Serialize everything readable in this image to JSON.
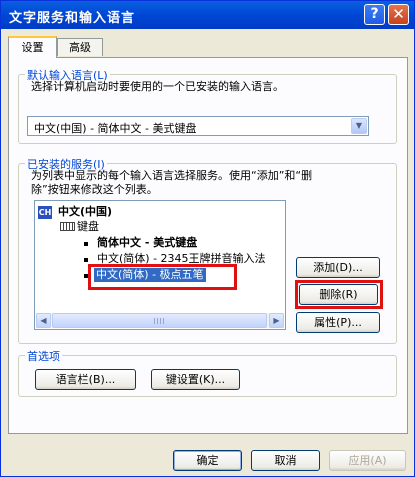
{
  "window": {
    "title": "文字服务和输入语言"
  },
  "tabs": [
    {
      "label": "设置",
      "active": true
    },
    {
      "label": "高级",
      "active": false
    }
  ],
  "default_input": {
    "legend": "默认输入语言(L)",
    "description": "选择计算机启动时要使用的一个已安装的输入语言。",
    "selected": "中文(中国) - 简体中文 - 美式键盘"
  },
  "installed_services": {
    "legend": "已安装的服务(I)",
    "description_line1": "为列表中显示的每个输入语言选择服务。使用“添加”和“删",
    "description_line2": "除”按钮来修改这个列表。",
    "tree": {
      "language": "中文(中国)",
      "language_badge": "CH",
      "category": "键盘",
      "items": [
        {
          "label": "简体中文 - 美式键盘",
          "bold": true
        },
        {
          "label": "中文(简体) - 2345王牌拼音输入法",
          "bold": false
        },
        {
          "label": "中文(简体) - 极点五笔",
          "bold": false,
          "selected": true
        }
      ]
    },
    "buttons": {
      "add": "添加(D)...",
      "remove": "删除(R)",
      "properties": "属性(P)..."
    }
  },
  "preferences": {
    "legend": "首选项",
    "buttons": {
      "language_bar": "语言栏(B)...",
      "key_settings": "键设置(K)..."
    }
  },
  "dialog_buttons": {
    "ok": "确定",
    "cancel": "取消",
    "apply": "应用(A)"
  },
  "icons": {
    "help": "help-icon",
    "close": "close-icon",
    "dropdown": "chevron-down-icon",
    "language": "language-badge-icon",
    "keyboard": "keyboard-icon"
  },
  "colors": {
    "title_bar": "#0054e3",
    "selection": "#316ac5",
    "highlight_box": "#e01010",
    "group_legend": "#0046d5"
  }
}
